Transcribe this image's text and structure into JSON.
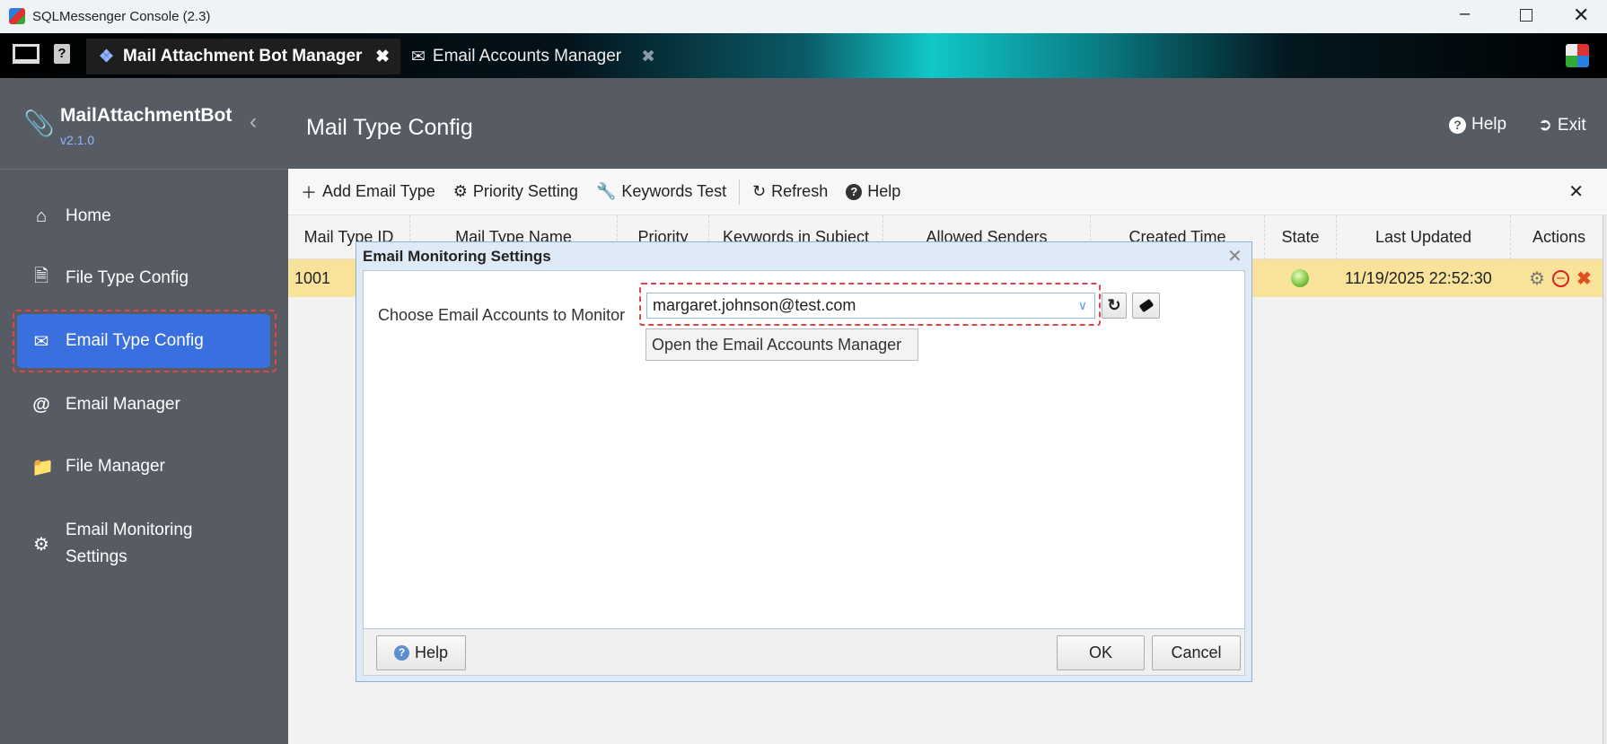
{
  "window": {
    "title": "SQLMessenger Console (2.3)",
    "controls": [
      "minimize",
      "maximize",
      "close"
    ]
  },
  "tabs": [
    {
      "label": "Mail Attachment Bot Manager",
      "active": true
    },
    {
      "label": "Email Accounts Manager",
      "active": false
    }
  ],
  "header": {
    "app_name": "MailAttachmentBot",
    "version": "v2.1.0",
    "page_title": "Mail Type Config",
    "help": "Help",
    "exit": "Exit"
  },
  "sidebar": {
    "items": [
      {
        "label": "Home",
        "icon": "home-icon"
      },
      {
        "label": "File Type Config",
        "icon": "file-code-icon"
      },
      {
        "label": "Email Type Config",
        "icon": "envelope-icon",
        "active": true
      },
      {
        "label": "Email Manager",
        "icon": "at-icon"
      },
      {
        "label": "File Manager",
        "icon": "folder-icon"
      },
      {
        "label": "Email Monitoring Settings",
        "icon": "gear-icon"
      }
    ]
  },
  "toolbar": {
    "add": "Add Email Type",
    "priority": "Priority Setting",
    "keywords": "Keywords Test",
    "refresh": "Refresh",
    "help": "Help"
  },
  "table": {
    "columns": [
      "Mail Type ID",
      "Mail Type Name",
      "Priority",
      "Keywords in Subject",
      "Allowed Senders",
      "Created Time",
      "State",
      "Last Updated",
      "Actions"
    ],
    "rows": [
      {
        "id": "1001",
        "state": "active",
        "last_updated": "11/19/2025 22:52:30"
      }
    ]
  },
  "dialog": {
    "title": "Email Monitoring Settings",
    "label": "Choose Email Accounts to Monitor",
    "selected_account": "margaret.johnson@test.com",
    "tooltip": "Open the Email Accounts Manager",
    "help": "Help",
    "ok": "OK",
    "cancel": "Cancel"
  },
  "colors": {
    "accent": "#3a6fe0",
    "highlight_row": "#f9e29a",
    "annotation": "#e0454a"
  }
}
